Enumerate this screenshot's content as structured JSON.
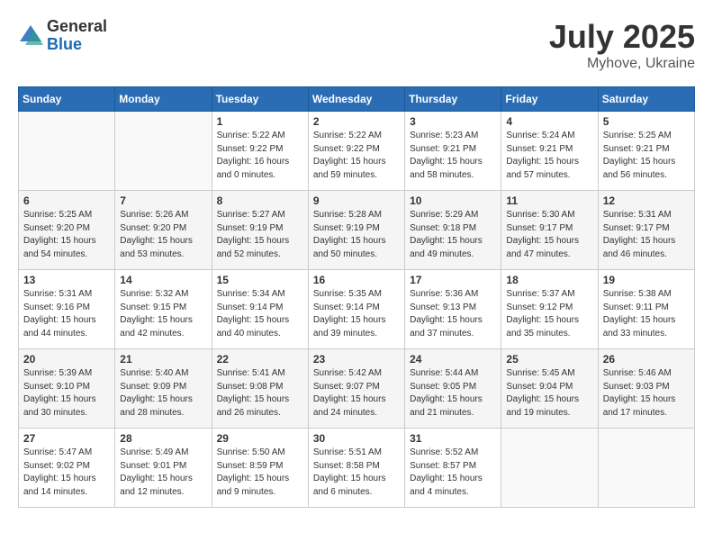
{
  "header": {
    "logo_general": "General",
    "logo_blue": "Blue",
    "month_year": "July 2025",
    "location": "Myhove, Ukraine"
  },
  "weekdays": [
    "Sunday",
    "Monday",
    "Tuesday",
    "Wednesday",
    "Thursday",
    "Friday",
    "Saturday"
  ],
  "weeks": [
    [
      {
        "day": "",
        "info": ""
      },
      {
        "day": "",
        "info": ""
      },
      {
        "day": "1",
        "info": "Sunrise: 5:22 AM\nSunset: 9:22 PM\nDaylight: 16 hours\nand 0 minutes."
      },
      {
        "day": "2",
        "info": "Sunrise: 5:22 AM\nSunset: 9:22 PM\nDaylight: 15 hours\nand 59 minutes."
      },
      {
        "day": "3",
        "info": "Sunrise: 5:23 AM\nSunset: 9:21 PM\nDaylight: 15 hours\nand 58 minutes."
      },
      {
        "day": "4",
        "info": "Sunrise: 5:24 AM\nSunset: 9:21 PM\nDaylight: 15 hours\nand 57 minutes."
      },
      {
        "day": "5",
        "info": "Sunrise: 5:25 AM\nSunset: 9:21 PM\nDaylight: 15 hours\nand 56 minutes."
      }
    ],
    [
      {
        "day": "6",
        "info": "Sunrise: 5:25 AM\nSunset: 9:20 PM\nDaylight: 15 hours\nand 54 minutes."
      },
      {
        "day": "7",
        "info": "Sunrise: 5:26 AM\nSunset: 9:20 PM\nDaylight: 15 hours\nand 53 minutes."
      },
      {
        "day": "8",
        "info": "Sunrise: 5:27 AM\nSunset: 9:19 PM\nDaylight: 15 hours\nand 52 minutes."
      },
      {
        "day": "9",
        "info": "Sunrise: 5:28 AM\nSunset: 9:19 PM\nDaylight: 15 hours\nand 50 minutes."
      },
      {
        "day": "10",
        "info": "Sunrise: 5:29 AM\nSunset: 9:18 PM\nDaylight: 15 hours\nand 49 minutes."
      },
      {
        "day": "11",
        "info": "Sunrise: 5:30 AM\nSunset: 9:17 PM\nDaylight: 15 hours\nand 47 minutes."
      },
      {
        "day": "12",
        "info": "Sunrise: 5:31 AM\nSunset: 9:17 PM\nDaylight: 15 hours\nand 46 minutes."
      }
    ],
    [
      {
        "day": "13",
        "info": "Sunrise: 5:31 AM\nSunset: 9:16 PM\nDaylight: 15 hours\nand 44 minutes."
      },
      {
        "day": "14",
        "info": "Sunrise: 5:32 AM\nSunset: 9:15 PM\nDaylight: 15 hours\nand 42 minutes."
      },
      {
        "day": "15",
        "info": "Sunrise: 5:34 AM\nSunset: 9:14 PM\nDaylight: 15 hours\nand 40 minutes."
      },
      {
        "day": "16",
        "info": "Sunrise: 5:35 AM\nSunset: 9:14 PM\nDaylight: 15 hours\nand 39 minutes."
      },
      {
        "day": "17",
        "info": "Sunrise: 5:36 AM\nSunset: 9:13 PM\nDaylight: 15 hours\nand 37 minutes."
      },
      {
        "day": "18",
        "info": "Sunrise: 5:37 AM\nSunset: 9:12 PM\nDaylight: 15 hours\nand 35 minutes."
      },
      {
        "day": "19",
        "info": "Sunrise: 5:38 AM\nSunset: 9:11 PM\nDaylight: 15 hours\nand 33 minutes."
      }
    ],
    [
      {
        "day": "20",
        "info": "Sunrise: 5:39 AM\nSunset: 9:10 PM\nDaylight: 15 hours\nand 30 minutes."
      },
      {
        "day": "21",
        "info": "Sunrise: 5:40 AM\nSunset: 9:09 PM\nDaylight: 15 hours\nand 28 minutes."
      },
      {
        "day": "22",
        "info": "Sunrise: 5:41 AM\nSunset: 9:08 PM\nDaylight: 15 hours\nand 26 minutes."
      },
      {
        "day": "23",
        "info": "Sunrise: 5:42 AM\nSunset: 9:07 PM\nDaylight: 15 hours\nand 24 minutes."
      },
      {
        "day": "24",
        "info": "Sunrise: 5:44 AM\nSunset: 9:05 PM\nDaylight: 15 hours\nand 21 minutes."
      },
      {
        "day": "25",
        "info": "Sunrise: 5:45 AM\nSunset: 9:04 PM\nDaylight: 15 hours\nand 19 minutes."
      },
      {
        "day": "26",
        "info": "Sunrise: 5:46 AM\nSunset: 9:03 PM\nDaylight: 15 hours\nand 17 minutes."
      }
    ],
    [
      {
        "day": "27",
        "info": "Sunrise: 5:47 AM\nSunset: 9:02 PM\nDaylight: 15 hours\nand 14 minutes."
      },
      {
        "day": "28",
        "info": "Sunrise: 5:49 AM\nSunset: 9:01 PM\nDaylight: 15 hours\nand 12 minutes."
      },
      {
        "day": "29",
        "info": "Sunrise: 5:50 AM\nSunset: 8:59 PM\nDaylight: 15 hours\nand 9 minutes."
      },
      {
        "day": "30",
        "info": "Sunrise: 5:51 AM\nSunset: 8:58 PM\nDaylight: 15 hours\nand 6 minutes."
      },
      {
        "day": "31",
        "info": "Sunrise: 5:52 AM\nSunset: 8:57 PM\nDaylight: 15 hours\nand 4 minutes."
      },
      {
        "day": "",
        "info": ""
      },
      {
        "day": "",
        "info": ""
      }
    ]
  ]
}
